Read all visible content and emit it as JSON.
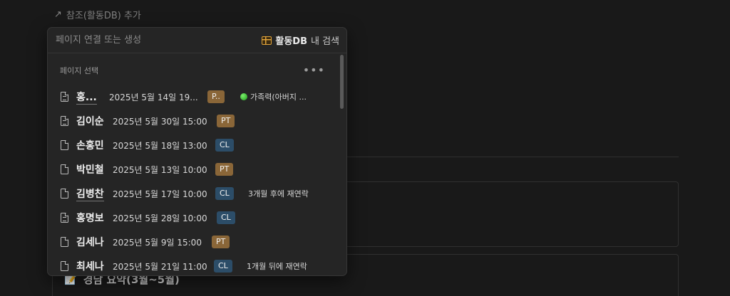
{
  "top_link": {
    "arrow": "↗",
    "label": "참조(활동DB) 추가"
  },
  "background": {
    "heading_icon": "📝",
    "heading": "경남 요약(3월~5월)"
  },
  "popup": {
    "search_placeholder": "페이지 연결 또는 생성",
    "scope_db": "활동DB",
    "scope_suffix": "내 검색",
    "section_label": "페이지 선택",
    "more": "•••",
    "rows": [
      {
        "name": "홍...",
        "date": "2025년 5월 14일 19...",
        "tag": "P..",
        "tag_type": "pt",
        "note": "가족력(아버지 ...",
        "note_icon": "green-circle"
      },
      {
        "name": "김이순",
        "date": "2025년 5월 30일 15:00",
        "tag": "PT",
        "tag_type": "pt",
        "note": ""
      },
      {
        "name": "손홍민",
        "date": "2025년 5월 18일 13:00",
        "tag": "CL",
        "tag_type": "cl",
        "note": ""
      },
      {
        "name": "박민철",
        "date": "2025년 5월 13일 10:00",
        "tag": "PT",
        "tag_type": "pt",
        "note": ""
      },
      {
        "name": "김병찬",
        "date": "2025년 5월 17일 10:00",
        "tag": "CL",
        "tag_type": "cl",
        "note": "3개월 후에 재연락"
      },
      {
        "name": "홍명보",
        "date": "2025년 5월 28일 10:00",
        "tag": "CL",
        "tag_type": "cl",
        "note": ""
      },
      {
        "name": "김세나",
        "date": "2025년 5월 9일 15:00",
        "tag": "PT",
        "tag_type": "pt",
        "note": ""
      },
      {
        "name": "최세나",
        "date": "2025년 5월 21일 11:00",
        "tag": "CL",
        "tag_type": "cl",
        "note": "1개월 뒤에 재연락"
      }
    ]
  }
}
